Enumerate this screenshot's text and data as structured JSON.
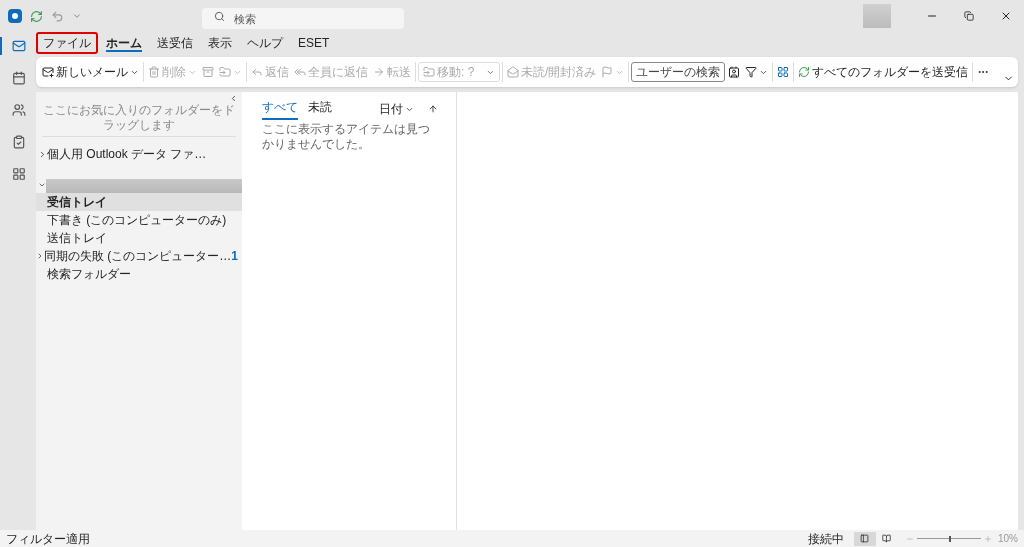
{
  "title_bar": {
    "search": {
      "placeholder": "検索"
    }
  },
  "menu_tabs": [
    {
      "label": "ファイル",
      "selected": false,
      "highlighted": true
    },
    {
      "label": "ホーム",
      "selected": true,
      "highlighted": false
    },
    {
      "label": "送受信",
      "selected": false,
      "highlighted": false
    },
    {
      "label": "表示",
      "selected": false,
      "highlighted": false
    },
    {
      "label": "ヘルプ",
      "selected": false,
      "highlighted": false
    },
    {
      "label": "ESET",
      "selected": false,
      "highlighted": false
    }
  ],
  "ribbon": [
    {
      "kind": "button",
      "label": "新しいメール",
      "dropdown": true,
      "disabled": false
    },
    {
      "kind": "divider"
    },
    {
      "kind": "button",
      "label": "削除",
      "dropdown": true,
      "disabled": true
    },
    {
      "kind": "button",
      "dropdown": false,
      "disabled": true
    },
    {
      "kind": "button",
      "dropdown": true,
      "disabled": true
    },
    {
      "kind": "divider"
    },
    {
      "kind": "button",
      "label": "返信",
      "dropdown": false,
      "disabled": true
    },
    {
      "kind": "button",
      "label": "全員に返信",
      "dropdown": false,
      "disabled": true
    },
    {
      "kind": "button",
      "label": "転送",
      "dropdown": false,
      "disabled": true
    },
    {
      "kind": "divider"
    },
    {
      "kind": "move",
      "label": "移動: ?",
      "disabled": true
    },
    {
      "kind": "divider"
    },
    {
      "kind": "button",
      "label": "未読/開封済み",
      "dropdown": false,
      "disabled": true
    },
    {
      "kind": "button",
      "dropdown": true,
      "disabled": true
    },
    {
      "kind": "divider"
    },
    {
      "kind": "search",
      "placeholder": "ユーザーの検索"
    },
    {
      "kind": "button",
      "dropdown": false,
      "disabled": false
    },
    {
      "kind": "button",
      "dropdown": true,
      "disabled": false
    },
    {
      "kind": "divider"
    },
    {
      "kind": "button",
      "dropdown": false,
      "disabled": false
    },
    {
      "kind": "divider"
    },
    {
      "kind": "button",
      "label": "すべてのフォルダーを送受信",
      "dropdown": false,
      "disabled": false
    },
    {
      "kind": "divider"
    },
    {
      "kind": "button",
      "dropdown": false,
      "disabled": false
    }
  ],
  "nav_rail": [
    {
      "selected": true
    },
    {
      "selected": false
    },
    {
      "selected": false
    },
    {
      "selected": false
    },
    {
      "selected": false
    }
  ],
  "folder_pane": {
    "favorites_hint": "ここにお気に入りのフォルダーをドラッグします",
    "groups": [
      {
        "kind": "named",
        "label": "個人用 Outlook データ ファ…",
        "expanded": false
      },
      {
        "kind": "redacted",
        "expanded": true,
        "children": [
          {
            "label": "受信トレイ",
            "selected": true,
            "expandable": false
          },
          {
            "label": "下書き (このコンピューターのみ)",
            "selected": false,
            "expandable": false
          },
          {
            "label": "送信トレイ",
            "selected": false,
            "expandable": false
          },
          {
            "label": "同期の失敗 (このコンピューター…",
            "selected": false,
            "expandable": true,
            "count": "1"
          },
          {
            "label": "検索フォルダー",
            "selected": false,
            "expandable": false
          }
        ]
      }
    ]
  },
  "message_list": {
    "tabs": [
      {
        "label": "すべて",
        "selected": true
      },
      {
        "label": "未読",
        "selected": false
      }
    ],
    "sort": "日付",
    "empty_text": "ここに表示するアイテムは見つかりませんでした。"
  },
  "status_bar": {
    "left": "フィルター適用",
    "connection": "接続中",
    "views": [
      {
        "selected": true
      },
      {
        "selected": false
      }
    ],
    "zoom": {
      "level": 0.5
    },
    "zoom_text": "10%"
  }
}
